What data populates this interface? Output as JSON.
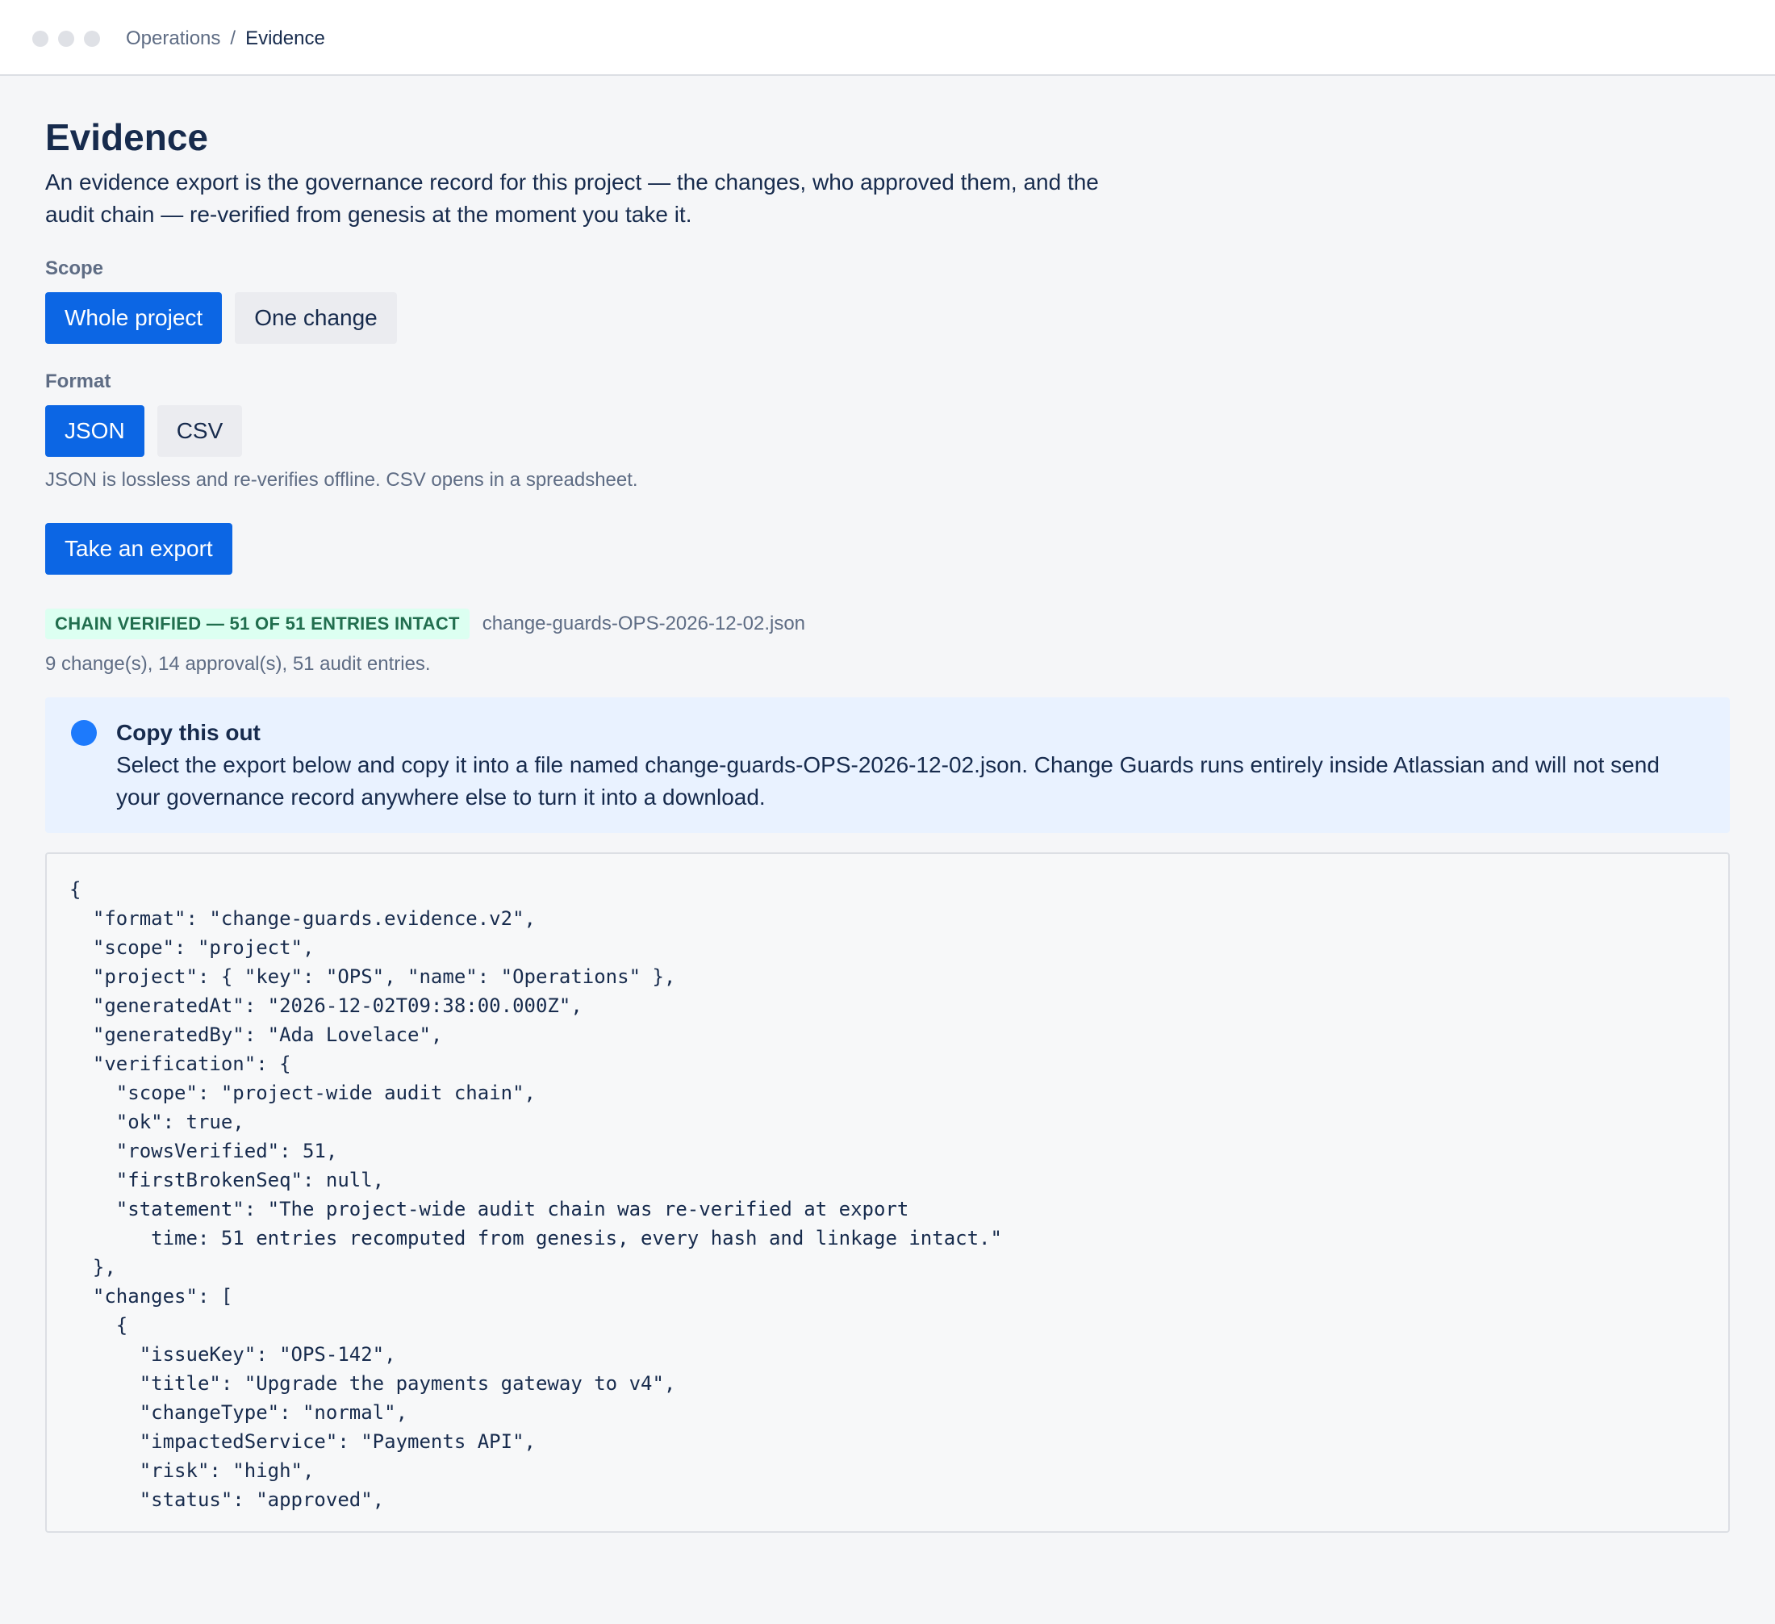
{
  "breadcrumb": {
    "parent": "Operations",
    "separator": "/",
    "current": "Evidence"
  },
  "page": {
    "title": "Evidence",
    "intro": "An evidence export is the governance record for this project — the changes, who approved them, and the audit chain — re-verified from genesis at the moment you take it."
  },
  "scope": {
    "label": "Scope",
    "options": [
      "Whole project",
      "One change"
    ],
    "selected": "Whole project"
  },
  "format": {
    "label": "Format",
    "options": [
      "JSON",
      "CSV"
    ],
    "selected": "JSON",
    "help": "JSON is lossless and re-verifies offline. CSV opens in a spreadsheet."
  },
  "actions": {
    "take_export": "Take an export"
  },
  "result": {
    "badge": "CHAIN VERIFIED — 51 OF 51 ENTRIES INTACT",
    "filename": "change-guards-OPS-2026-12-02.json",
    "counts": "9 change(s), 14 approval(s), 51 audit entries."
  },
  "notice": {
    "icon": "info-icon",
    "title": "Copy this out",
    "body": "Select the export below and copy it into a file named change-guards-OPS-2026-12-02.json. Change Guards runs entirely inside Atlassian and will not send your governance record anywhere else to turn it into a download."
  },
  "export_text": "{\n  \"format\": \"change-guards.evidence.v2\",\n  \"scope\": \"project\",\n  \"project\": { \"key\": \"OPS\", \"name\": \"Operations\" },\n  \"generatedAt\": \"2026-12-02T09:38:00.000Z\",\n  \"generatedBy\": \"Ada Lovelace\",\n  \"verification\": {\n    \"scope\": \"project-wide audit chain\",\n    \"ok\": true,\n    \"rowsVerified\": 51,\n    \"firstBrokenSeq\": null,\n    \"statement\": \"The project-wide audit chain was re-verified at export\n       time: 51 entries recomputed from genesis, every hash and linkage intact.\"\n  },\n  \"changes\": [\n    {\n      \"issueKey\": \"OPS-142\",\n      \"title\": \"Upgrade the payments gateway to v4\",\n      \"changeType\": \"normal\",\n      \"impactedService\": \"Payments API\",\n      \"risk\": \"high\",\n      \"status\": \"approved\",",
  "colors": {
    "primary": "#0c66e4",
    "text": "#172b4d",
    "subtle_text": "#5e6c84",
    "success_bg": "#dcfff1",
    "success_text": "#216e4e",
    "info_bg": "#e9f2ff",
    "info_icon": "#1d7afc",
    "page_bg": "#f5f6f8"
  }
}
